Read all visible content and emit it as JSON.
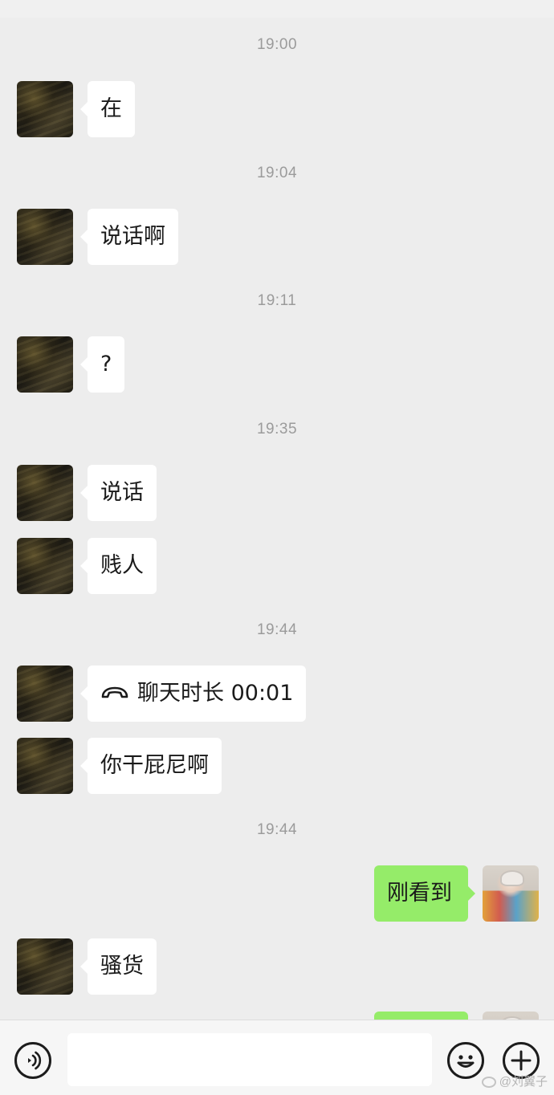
{
  "chat": {
    "timestamps": [
      "19:00",
      "19:04",
      "19:11",
      "19:35",
      "19:44",
      "19:44"
    ],
    "incoming_messages": [
      "在",
      "说话啊",
      "?",
      "说话",
      "贱人",
      "你干屁尼啊",
      "骚货"
    ],
    "call_record": {
      "label": "聊天时长 00:01",
      "icon": "phone-hangup-icon"
    },
    "outgoing_messages": [
      "刚看到",
      ""
    ]
  },
  "input_bar": {
    "voice_icon": "voice-icon",
    "text_value": "",
    "emoji_icon": "emoji-icon",
    "plus_icon": "plus-icon"
  },
  "watermark": {
    "text": "@刘翼子"
  },
  "colors": {
    "background": "#ededed",
    "incoming_bubble": "#ffffff",
    "outgoing_bubble": "#95ec69",
    "timestamp_text": "#9b9b9b",
    "input_bar": "#f6f6f6"
  }
}
